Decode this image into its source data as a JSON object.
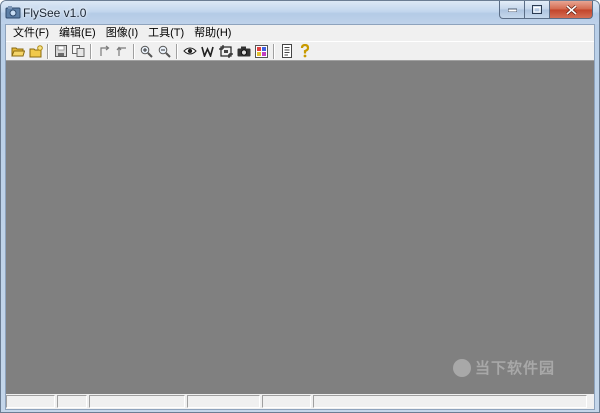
{
  "window": {
    "title": "FlySee v1.0"
  },
  "menu": {
    "items": [
      {
        "label": "文件(F)"
      },
      {
        "label": "编辑(E)"
      },
      {
        "label": "图像(I)"
      },
      {
        "label": "工具(T)"
      },
      {
        "label": "帮助(H)"
      }
    ]
  },
  "toolbar": {
    "groups": [
      [
        "open-folder-icon",
        "new-folder-icon"
      ],
      [
        "save-icon",
        "copy-icon"
      ],
      [
        "rotate-left-icon",
        "rotate-right-icon"
      ],
      [
        "zoom-in-icon",
        "zoom-out-icon"
      ],
      [
        "eye-icon",
        "wallpaper-icon",
        "capture-icon",
        "camera-icon",
        "palette-icon"
      ],
      [
        "document-icon",
        "help-icon"
      ]
    ]
  },
  "status": {
    "panes": [
      "",
      "",
      "",
      "",
      "",
      ""
    ]
  },
  "watermark": {
    "text": "当下软件园"
  },
  "colors": {
    "canvas": "#808080",
    "chrome": "#f0f0f0",
    "close": "#c2442a"
  }
}
